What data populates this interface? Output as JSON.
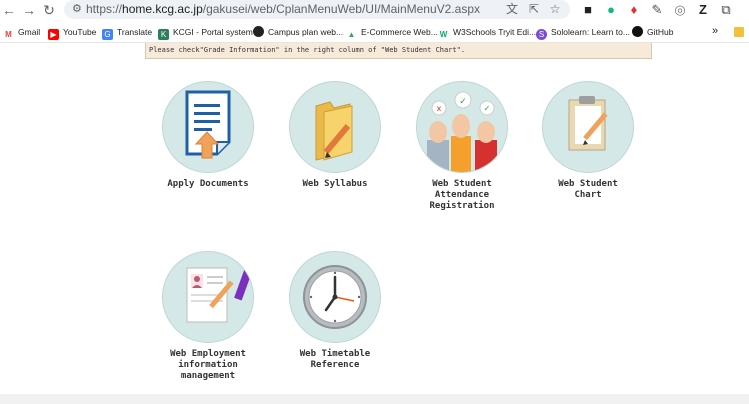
{
  "browser": {
    "url_scheme": "https://",
    "url_host": "home.kcg.ac.jp",
    "url_path": "/gakusei/web/CplanMenuWeb/UI/MainMenuV2.aspx"
  },
  "bookmarks": [
    {
      "label": "Gmail",
      "icon": "gmail-icon",
      "color": "#ea4335",
      "glyph": "M"
    },
    {
      "label": "YouTube",
      "icon": "youtube-icon",
      "color": "#ff0000",
      "glyph": "▶"
    },
    {
      "label": "Translate",
      "icon": "translate-icon",
      "color": "#4285f4",
      "glyph": "G"
    },
    {
      "label": "KCGI - Portal system",
      "icon": "kcgi-icon",
      "color": "#2e7d5b",
      "glyph": "K"
    },
    {
      "label": "Campus plan web...",
      "icon": "campus-icon",
      "color": "#222222",
      "glyph": "●"
    },
    {
      "label": "E-Commerce Web...",
      "icon": "ecommerce-icon",
      "color": "#34a853",
      "glyph": "▲"
    },
    {
      "label": "W3Schools Tryit Edi...",
      "icon": "w3schools-icon",
      "color": "#04aa6d",
      "glyph": "W"
    },
    {
      "label": "Sololearn: Learn to...",
      "icon": "sololearn-icon",
      "color": "#7a4bd6",
      "glyph": "S"
    },
    {
      "label": "GitHub",
      "icon": "github-icon",
      "color": "#111111",
      "glyph": "●"
    }
  ],
  "bookmarks_more": "»",
  "notice": "Please check\"Grade Information\" in the right column of \"Web Student Chart\".",
  "tiles": [
    {
      "label": "Apply Documents"
    },
    {
      "label": "Web Syllabus"
    },
    {
      "label": "Web Student\nAttendance\nRegistration"
    },
    {
      "label": "Web Student\nChart"
    },
    {
      "label": "Web Employment\ninformation\nmanagement"
    },
    {
      "label": "Web Timetable\nReference"
    }
  ]
}
